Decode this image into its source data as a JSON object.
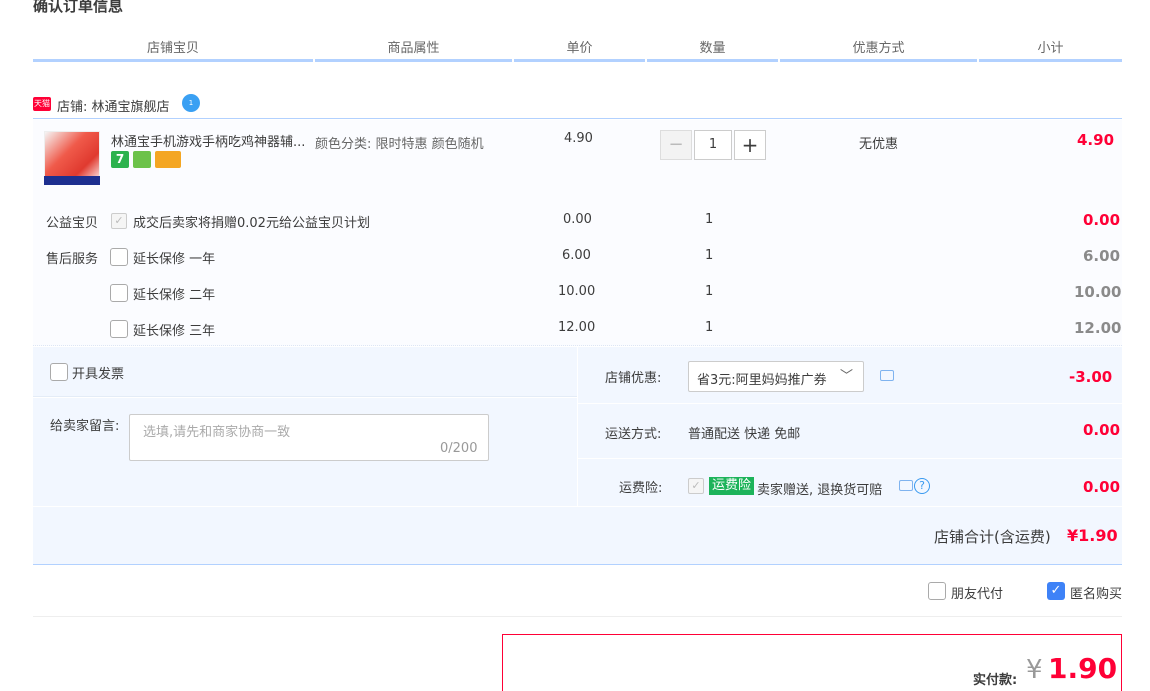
{
  "page_title": "确认订单信息",
  "columns": [
    "店铺宝贝",
    "商品属性",
    "单价",
    "数量",
    "优惠方式",
    "小计"
  ],
  "shop": {
    "badge": "天猫",
    "name": "店铺: 林通宝旗舰店"
  },
  "product": {
    "title": "林通宝手机游戏手柄吃鸡神器辅...",
    "attributes": "颜色分类: 限时特惠 颜色随机",
    "unit_price": "4.90",
    "quantity": "1",
    "qty_minus": "−",
    "qty_plus": "+",
    "discount": "无优惠",
    "subtotal": "4.90",
    "badge_colors": [
      "#2cb24e",
      "#6cc24a",
      "#f4a623"
    ]
  },
  "charity": {
    "label": "公益宝贝",
    "text": "成交后卖家将捐赠0.02元给公益宝贝计划",
    "price": "0.00",
    "qty": "1",
    "subtotal": "0.00"
  },
  "after_sales": {
    "label": "售后服务",
    "options": [
      {
        "text": "延长保修 一年",
        "price": "6.00",
        "qty": "1",
        "subtotal": "6.00"
      },
      {
        "text": "延长保修 二年",
        "price": "10.00",
        "qty": "1",
        "subtotal": "10.00"
      },
      {
        "text": "延长保修 三年",
        "price": "12.00",
        "qty": "1",
        "subtotal": "12.00"
      }
    ]
  },
  "invoice": {
    "label": "开具发票"
  },
  "message": {
    "label": "给卖家留言:",
    "placeholder": "选填,请先和商家协商一致",
    "count": "0/200"
  },
  "shop_discount": {
    "label": "店铺优惠:",
    "selected": "省3元:阿里妈妈推广券",
    "amount": "-3.00"
  },
  "shipping": {
    "label": "运送方式:",
    "value": "普通配送 快递 免邮",
    "amount": "0.00"
  },
  "shipping_insurance": {
    "label": "运费险:",
    "badge": "运费险",
    "text": "卖家赠送, 退换货可赔",
    "help": "?",
    "amount": "0.00"
  },
  "shop_total": {
    "label": "店铺合计(含运费)",
    "value": "¥1.90"
  },
  "options": {
    "friend_pay": "朋友代付",
    "anonymous": "匿名购买"
  },
  "payment": {
    "label": "实付款:",
    "currency": "¥",
    "value": "1.90"
  },
  "colors": {
    "accent_red": "#ff0036",
    "header_line": "#b2d1ff",
    "panel_bg": "#f2f7ff",
    "checkbox_blue": "#3e82f7"
  }
}
